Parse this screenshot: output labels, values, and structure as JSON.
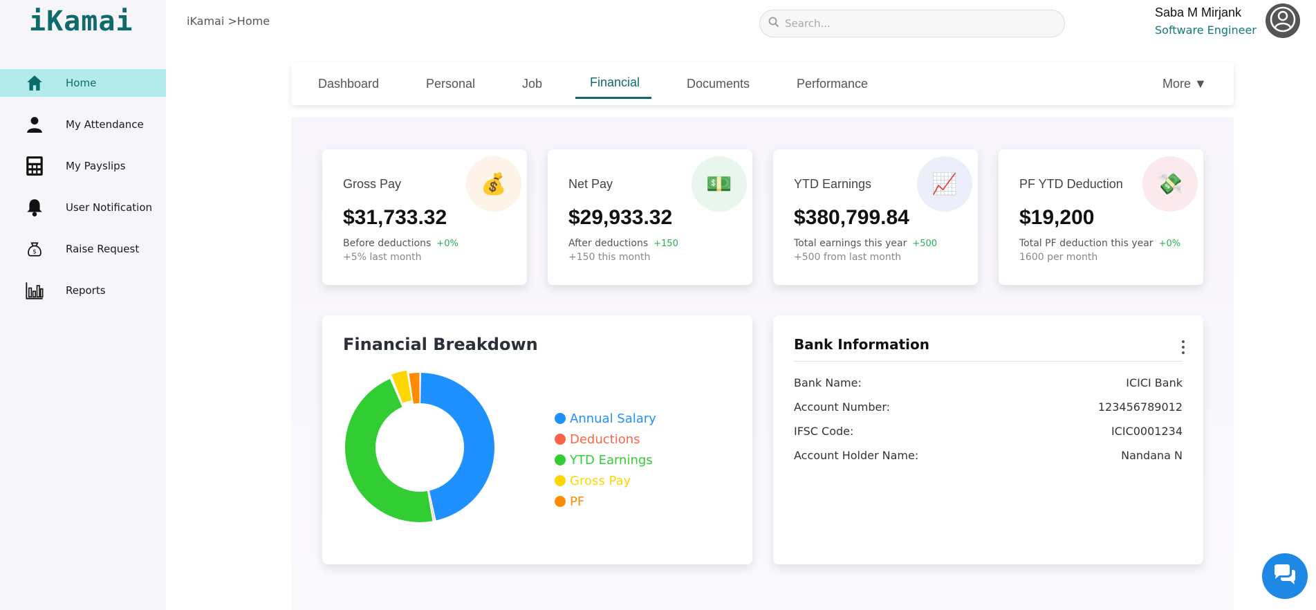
{
  "app": {
    "logo": "iKamai"
  },
  "breadcrumb": "iKamai >Home",
  "search": {
    "placeholder": "Search..."
  },
  "user": {
    "name": "Saba M Mirjank",
    "role": "Software Engineer"
  },
  "sidebar": {
    "items": [
      {
        "label": "Home",
        "icon": "home-icon",
        "active": true
      },
      {
        "label": "My Attendance",
        "icon": "person-icon",
        "active": false
      },
      {
        "label": "My Payslips",
        "icon": "calculator-icon",
        "active": false
      },
      {
        "label": "User Notification",
        "icon": "bell-icon",
        "active": false
      },
      {
        "label": "Raise Request",
        "icon": "money-bag-icon",
        "active": false
      },
      {
        "label": "Reports",
        "icon": "bar-chart-icon",
        "active": false
      }
    ]
  },
  "tabs": [
    {
      "label": "Dashboard"
    },
    {
      "label": "Personal"
    },
    {
      "label": "Job"
    },
    {
      "label": "Financial",
      "active": true
    },
    {
      "label": "Documents"
    },
    {
      "label": "Performance"
    },
    {
      "label": "More ▼"
    }
  ],
  "stats": [
    {
      "title": "Gross Pay",
      "value": "$31,733.32",
      "sub": "Before deductions",
      "delta": "+0%",
      "sub2": "+5% last month",
      "icon": "money-bag-icon",
      "glyph": "💰",
      "icon_bg": "#fdf3e6"
    },
    {
      "title": "Net Pay",
      "value": "$29,933.32",
      "sub": "After deductions",
      "delta": "+150",
      "sub2": "+150 this month",
      "icon": "dollar-bill-icon",
      "glyph": "💵",
      "icon_bg": "#e8f6ee"
    },
    {
      "title": "YTD Earnings",
      "value": "$380,799.84",
      "sub": "Total earnings this year",
      "delta": "+500",
      "sub2": "+500 from last month",
      "icon": "trend-chart-icon",
      "glyph": "📈",
      "icon_bg": "#eceefa"
    },
    {
      "title": "PF YTD Deduction",
      "value": "$19,200",
      "sub": "Total PF deduction this year",
      "delta": "+0%",
      "sub2": "1600 per month",
      "icon": "money-wings-icon",
      "glyph": "💸",
      "icon_bg": "#fbe9ee"
    }
  ],
  "breakdown": {
    "title": "Financial Breakdown",
    "chart_data": {
      "type": "pie",
      "categories": [
        "Annual Salary",
        "Deductions",
        "YTD Earnings",
        "Gross Pay",
        "PF"
      ],
      "values": [
        380799.84,
        1800,
        380799.84,
        31733.32,
        19200
      ],
      "colors": [
        "#1e90ff",
        "#ff6347",
        "#32cd32",
        "#ffd700",
        "#ff8c00"
      ],
      "donut": true,
      "legend_position": "right"
    }
  },
  "bank": {
    "title": "Bank Information",
    "rows": [
      {
        "label": "Bank Name:",
        "value": "ICICI Bank"
      },
      {
        "label": "Account Number:",
        "value": "123456789012"
      },
      {
        "label": "IFSC Code:",
        "value": "ICIC0001234"
      },
      {
        "label": "Account Holder Name:",
        "value": "Nandana N"
      }
    ]
  },
  "colors": {
    "brand": "#0f6b6b",
    "active_nav_bg": "#b2ebea",
    "chat": "#1e88e5"
  }
}
